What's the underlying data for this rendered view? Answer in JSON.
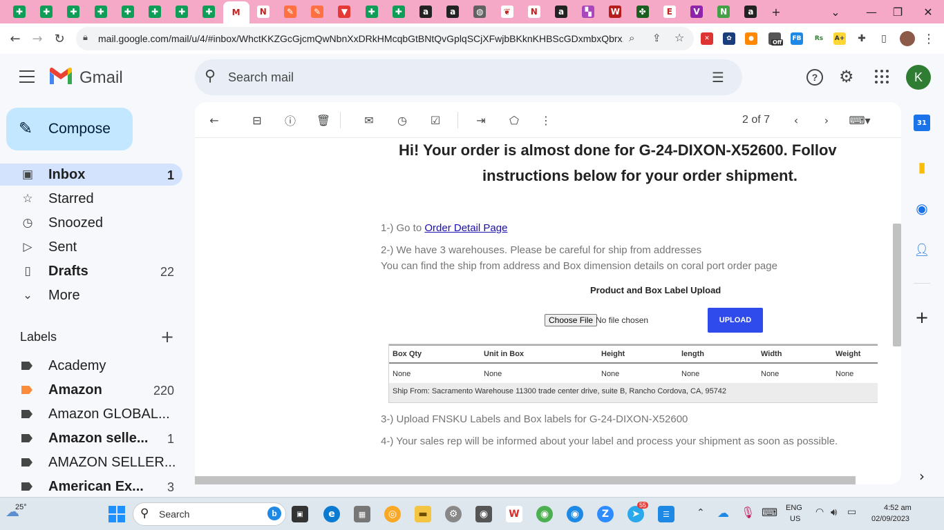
{
  "browser": {
    "tabs": [
      {
        "icon": "google-sheets-icon",
        "active": false
      },
      {
        "icon": "google-sheets-icon",
        "active": false
      },
      {
        "icon": "google-sheets-icon",
        "active": false
      },
      {
        "icon": "google-sheets-icon",
        "active": false
      },
      {
        "icon": "google-sheets-icon",
        "active": false
      },
      {
        "icon": "google-sheets-icon",
        "active": false
      },
      {
        "icon": "google-sheets-icon",
        "active": false
      },
      {
        "icon": "google-sheets-icon",
        "active": false
      },
      {
        "icon": "gmail-icon",
        "active": true
      },
      {
        "icon": "notion-icon",
        "active": false
      },
      {
        "icon": "pencil-app-icon",
        "active": false
      },
      {
        "icon": "pencil-app-icon",
        "active": false
      },
      {
        "icon": "triangle-app-icon",
        "active": false
      },
      {
        "icon": "google-sheets-icon",
        "active": false
      },
      {
        "icon": "google-sheets-icon",
        "active": false
      },
      {
        "icon": "amazon-icon",
        "active": false
      },
      {
        "icon": "amazon-icon",
        "active": false
      },
      {
        "icon": "globe-icon",
        "active": false
      },
      {
        "icon": "leaf-icon",
        "active": false
      },
      {
        "icon": "notion-icon",
        "active": false
      },
      {
        "icon": "amazon-icon",
        "active": false
      },
      {
        "icon": "multicolor-app-icon",
        "active": false
      },
      {
        "icon": "w-app-icon",
        "active": false
      },
      {
        "icon": "puzzle-icon",
        "active": false
      },
      {
        "icon": "efd-icon",
        "active": false
      },
      {
        "icon": "v-app-icon",
        "active": false
      },
      {
        "icon": "n-app-icon",
        "active": false
      },
      {
        "icon": "amazon-icon",
        "active": false
      }
    ],
    "url": "mail.google.com/mail/u/4/#inbox/WhctKKZGcGjcmQwNbnXxDRkHMcqbGtBNtQvGplqSCjXFwjbBKknKHBScGDxmbxQbrx...",
    "extension_badge": "Off",
    "avatar_letter": ""
  },
  "gmail": {
    "logo_text": "Gmail",
    "search_placeholder": "Search mail",
    "account_letter": "K",
    "compose_label": "Compose",
    "nav": [
      {
        "label": "Inbox",
        "count": "1",
        "icon": "inbox-icon",
        "bold": true,
        "active": true
      },
      {
        "label": "Starred",
        "count": "",
        "icon": "star-icon",
        "bold": false,
        "active": false
      },
      {
        "label": "Snoozed",
        "count": "",
        "icon": "clock-icon",
        "bold": false,
        "active": false
      },
      {
        "label": "Sent",
        "count": "",
        "icon": "send-icon",
        "bold": false,
        "active": false
      },
      {
        "label": "Drafts",
        "count": "22",
        "icon": "draft-icon",
        "bold": true,
        "active": false
      },
      {
        "label": "More",
        "count": "",
        "icon": "chevron-down-icon",
        "bold": false,
        "active": false
      }
    ],
    "labels_heading": "Labels",
    "labels": [
      {
        "label": "Academy",
        "count": "",
        "bold": false,
        "color": "#444746"
      },
      {
        "label": "Amazon",
        "count": "220",
        "bold": true,
        "color": "#fb8c3c"
      },
      {
        "label": "Amazon GLOBAL...",
        "count": "",
        "bold": false,
        "color": "#444746"
      },
      {
        "label": "Amazon selle...",
        "count": "1",
        "bold": true,
        "color": "#444746"
      },
      {
        "label": "AMAZON SELLER...",
        "count": "",
        "bold": false,
        "color": "#444746"
      },
      {
        "label": "American Ex...",
        "count": "3",
        "bold": true,
        "color": "#444746"
      }
    ],
    "pagination": "2 of 7"
  },
  "email": {
    "heading_line1": "Hi! Your order is almost done for G-24-DIXON-X52600. Follov",
    "heading_line2": "instructions below for your order shipment.",
    "step1_prefix": "1-) Go to ",
    "step1_link": "Order Detail Page",
    "step2_line1": "2-) We have 3 warehouses. Please be careful for ship from addresses",
    "step2_line2": "You can find the ship from address and Box dimension details on coral port order page",
    "upload_title": "Product and Box Label Upload",
    "choose_file": "Choose File",
    "no_file": "No file chosen",
    "upload_button": "UPLOAD",
    "table": {
      "headers": [
        "Box Qty",
        "Unit in Box",
        "Height",
        "length",
        "Width",
        "Weight"
      ],
      "row": [
        "None",
        "None",
        "None",
        "None",
        "None",
        "None"
      ],
      "ship_from": "Ship From: Sacramento Warehouse 11300 trade center drive, suite B, Rancho Cordova, CA, 95742"
    },
    "step3": "3-) Upload FNSKU Labels and Box labels for G-24-DIXON-X52600",
    "step4": "4-) Your sales rep will be informed about your label and process your shipment as soon as possible."
  },
  "side_panel": {
    "calendar_day": "31"
  },
  "taskbar": {
    "weather_temp": "25°",
    "search_label": "Search",
    "lang_line1": "ENG",
    "lang_line2": "US",
    "time": "4:52 am",
    "date": "02/09/2023",
    "telegram_badge": "55"
  }
}
